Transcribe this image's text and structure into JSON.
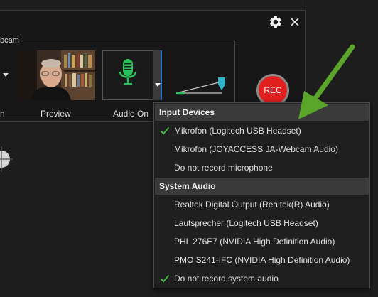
{
  "panel": {
    "group_label": "bcam",
    "labels": {
      "cut_left": "n",
      "preview": "Preview",
      "audio": "Audio On"
    },
    "rec_label": "REC"
  },
  "menu": {
    "sections": [
      {
        "header": "Input Devices",
        "items": [
          {
            "label": "Mikrofon (Logitech USB Headset)",
            "checked": true
          },
          {
            "label": "Mikrofon (JOYACCESS JA-Webcam Audio)",
            "checked": false
          },
          {
            "label": "Do not record microphone",
            "checked": false
          }
        ]
      },
      {
        "header": "System Audio",
        "items": [
          {
            "label": "Realtek Digital Output (Realtek(R) Audio)",
            "checked": false
          },
          {
            "label": "Lautsprecher (Logitech USB Headset)",
            "checked": false
          },
          {
            "label": "PHL 276E7 (NVIDIA High Definition Audio)",
            "checked": false
          },
          {
            "label": "PMO S241-IFC (NVIDIA High Definition Audio)",
            "checked": false
          },
          {
            "label": "Do not record system audio",
            "checked": true
          }
        ]
      }
    ]
  },
  "colors": {
    "check": "#3dbb3d",
    "mic": "#2fbf5a",
    "rec": "#e11f1f",
    "arrow": "#5aa52a",
    "level_cursor": "#2fb3c9"
  },
  "icons": {
    "gear": "gear-icon",
    "close": "close-icon",
    "mic": "microphone-icon",
    "check": "checkmark-icon"
  }
}
